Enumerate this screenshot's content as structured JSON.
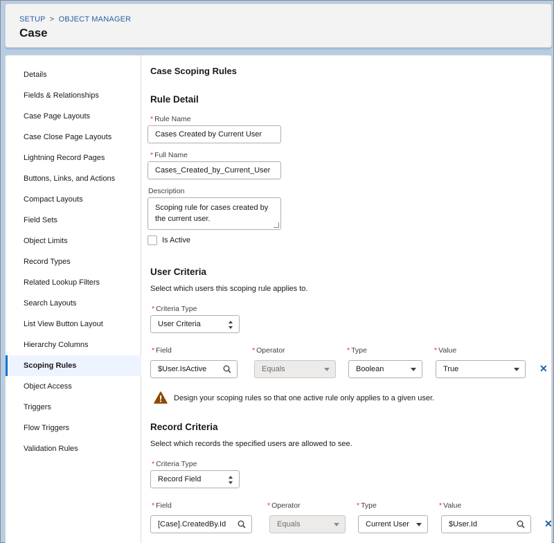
{
  "header": {
    "breadcrumb": {
      "setup": "SETUP",
      "separator": ">",
      "object_manager": "OBJECT MANAGER"
    },
    "title": "Case"
  },
  "sidebar": {
    "items": [
      {
        "label": "Details"
      },
      {
        "label": "Fields & Relationships"
      },
      {
        "label": "Case Page Layouts"
      },
      {
        "label": "Case Close Page Layouts"
      },
      {
        "label": "Lightning Record Pages"
      },
      {
        "label": "Buttons, Links, and Actions"
      },
      {
        "label": "Compact Layouts"
      },
      {
        "label": "Field Sets"
      },
      {
        "label": "Object Limits"
      },
      {
        "label": "Record Types"
      },
      {
        "label": "Related Lookup Filters"
      },
      {
        "label": "Search Layouts"
      },
      {
        "label": "List View Button Layout"
      },
      {
        "label": "Hierarchy Columns"
      },
      {
        "label": "Scoping Rules",
        "active": true
      },
      {
        "label": "Object Access"
      },
      {
        "label": "Triggers"
      },
      {
        "label": "Flow Triggers"
      },
      {
        "label": "Validation Rules"
      }
    ]
  },
  "main": {
    "title": "Case Scoping Rules",
    "rule_detail": {
      "heading": "Rule Detail",
      "required_marker": "*",
      "rule_name_label": "Rule Name",
      "rule_name_value": "Cases Created by Current User",
      "full_name_label": "Full Name",
      "full_name_value": "Cases_Created_by_Current_User",
      "description_label": "Description",
      "description_value": "Scoping rule for cases created by the current user.",
      "is_active_label": "Is Active",
      "is_active_checked": false
    },
    "user_criteria": {
      "heading": "User Criteria",
      "help": "Select which users this scoping rule applies to.",
      "criteria_type_label": "Criteria Type",
      "criteria_type_value": "User Criteria",
      "field_label": "Field",
      "operator_label": "Operator",
      "type_label": "Type",
      "value_label": "Value",
      "field_value": "$User.IsActive",
      "operator_value": "Equals",
      "type_value": "Boolean",
      "value_value": "True",
      "warning": "Design your scoping rules so that one active rule only applies to a given user."
    },
    "record_criteria": {
      "heading": "Record Criteria",
      "help": "Select which records the specified users are allowed to see.",
      "criteria_type_label": "Criteria Type",
      "criteria_type_value": "Record Field",
      "field_label": "Field",
      "operator_label": "Operator",
      "type_label": "Type",
      "value_label": "Value",
      "field_value": "[Case].CreatedBy.Id",
      "operator_value": "Equals",
      "type_value": "Current User",
      "value_value": "$User.Id"
    },
    "remove_symbol": "✕"
  },
  "colors": {
    "accent": "#0176d3",
    "required": "#c23934",
    "link": "#2a5f9e",
    "warning": "#8c4b02",
    "background": "#b6cde6"
  }
}
